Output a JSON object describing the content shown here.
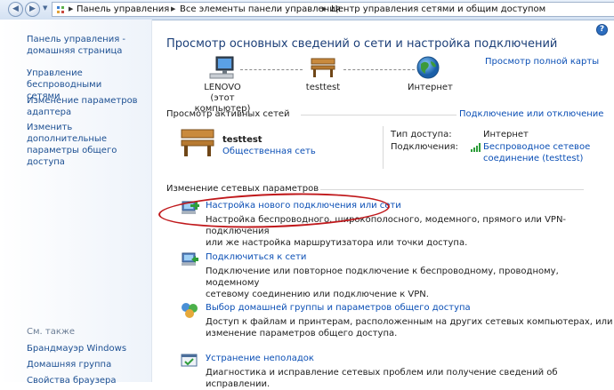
{
  "breadcrumb": {
    "items": [
      "Панель управления",
      "Все элементы панели управления",
      "Центр управления сетями и общим доступом"
    ]
  },
  "sidebar": {
    "links": [
      {
        "label": "Панель управления -\nдомашняя страница"
      },
      {
        "label": "Управление беспроводными\nсетями"
      },
      {
        "label": "Изменение параметров\nадаптера"
      },
      {
        "label": "Изменить дополнительные\nпараметры общего доступа"
      }
    ],
    "see_also_title": "См. также",
    "see_also": [
      "Брандмауэр Windows",
      "Домашняя группа",
      "Свойства браузера"
    ]
  },
  "main": {
    "title": "Просмотр основных сведений о сети и настройка подключений",
    "full_map_link": "Просмотр полной карты",
    "nodes": [
      {
        "label": "LENOVO\n(этот компьютер)",
        "icon": "computer-icon"
      },
      {
        "label": "testtest",
        "icon": "bench-icon"
      },
      {
        "label": "Интернет",
        "icon": "globe-icon"
      }
    ],
    "active_networks": {
      "header": "Просмотр активных сетей",
      "connect_link": "Подключение или отключение",
      "network_name": "testtest",
      "network_type": "Общественная сеть",
      "access_type_label": "Тип доступа:",
      "access_type_value": "Интернет",
      "connections_label": "Подключения:",
      "connection_value": "Беспроводное сетевое\nсоединение (testtest)"
    },
    "change_settings": {
      "header": "Изменение сетевых параметров",
      "tasks": [
        {
          "title": "Настройка нового подключения или сети",
          "desc": "Настройка беспроводного, широкополосного, модемного, прямого или VPN-подключения\nили же настройка маршрутизатора или точки доступа."
        },
        {
          "title": "Подключиться к сети",
          "desc": "Подключение или повторное подключение к беспроводному, проводному, модемному\nсетевому соединению или подключение к VPN."
        },
        {
          "title": "Выбор домашней группы и параметров общего доступа",
          "desc": "Доступ к файлам и принтерам, расположенным на других сетевых компьютерах, или\nизменение параметров общего доступа."
        },
        {
          "title": "Устранение неполадок",
          "desc": "Диагностика и исправление сетевых проблем или получение сведений об исправлении."
        }
      ]
    }
  },
  "colors": {
    "link": "#0b4fb5",
    "title": "#1c3f78",
    "annotation": "#c0181b"
  }
}
